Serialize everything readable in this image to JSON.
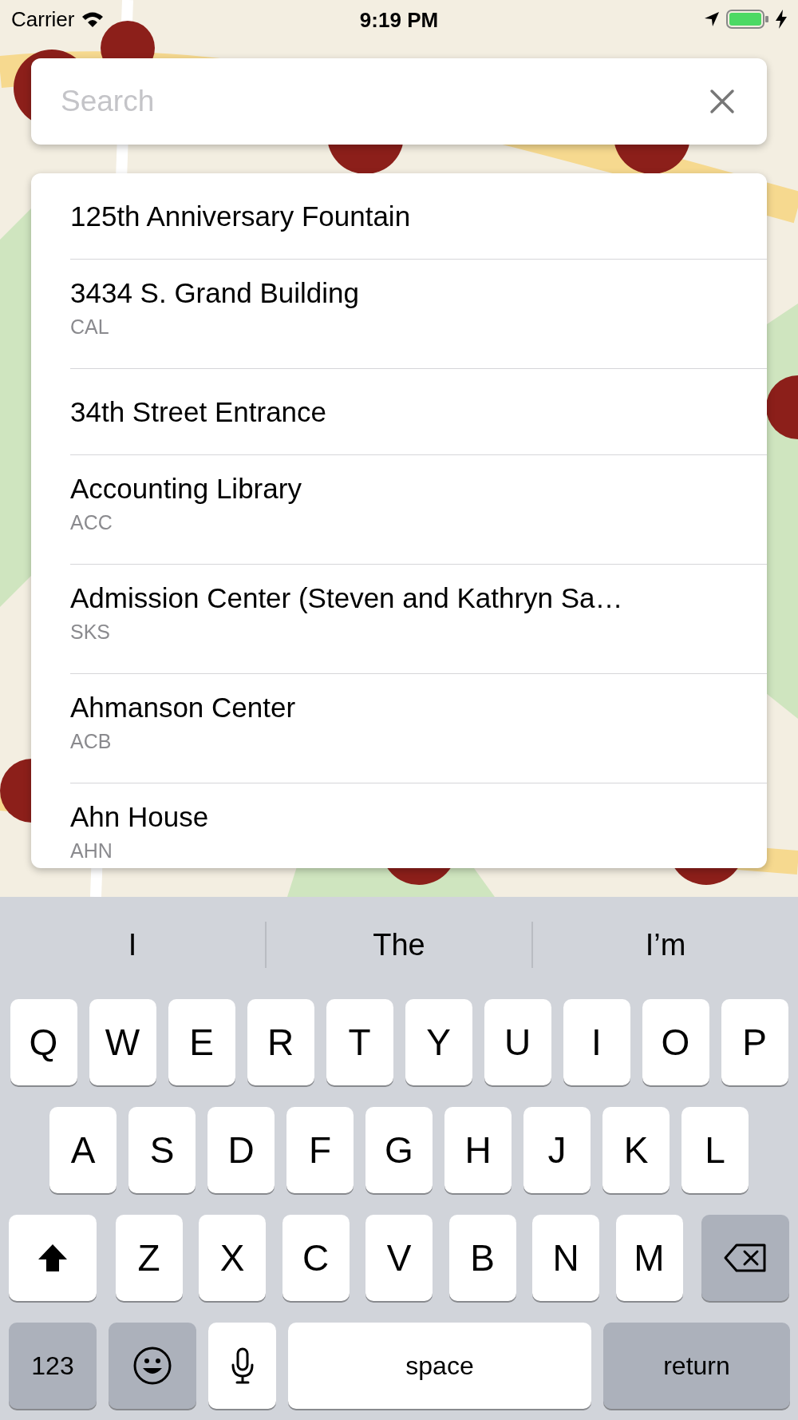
{
  "status_bar": {
    "carrier": "Carrier",
    "time": "9:19 PM"
  },
  "search": {
    "placeholder": "Search"
  },
  "results": [
    {
      "title": "125th Anniversary Fountain"
    },
    {
      "title": "3434 S. Grand Building",
      "code": "CAL"
    },
    {
      "title": "34th Street Entrance"
    },
    {
      "title": "Accounting Library",
      "code": "ACC"
    },
    {
      "title": "Admission Center (Steven and Kathryn Sa…",
      "code": "SKS"
    },
    {
      "title": "Ahmanson Center",
      "code": "ACB"
    },
    {
      "title": "Ahn House",
      "code": "AHN"
    }
  ],
  "keyboard": {
    "suggestions": [
      "I",
      "The",
      "I’m"
    ],
    "rows": [
      {
        "keys": [
          {
            "kind": "letter",
            "label": "Q"
          },
          {
            "kind": "letter",
            "label": "W"
          },
          {
            "kind": "letter",
            "label": "E"
          },
          {
            "kind": "letter",
            "label": "R"
          },
          {
            "kind": "letter",
            "label": "T"
          },
          {
            "kind": "letter",
            "label": "Y"
          },
          {
            "kind": "letter",
            "label": "U"
          },
          {
            "kind": "letter",
            "label": "I"
          },
          {
            "kind": "letter",
            "label": "O"
          },
          {
            "kind": "letter",
            "label": "P"
          }
        ]
      },
      {
        "keys": [
          {
            "kind": "letter",
            "label": "A"
          },
          {
            "kind": "letter",
            "label": "S"
          },
          {
            "kind": "letter",
            "label": "D"
          },
          {
            "kind": "letter",
            "label": "F"
          },
          {
            "kind": "letter",
            "label": "G"
          },
          {
            "kind": "letter",
            "label": "H"
          },
          {
            "kind": "letter",
            "label": "J"
          },
          {
            "kind": "letter",
            "label": "K"
          },
          {
            "kind": "letter",
            "label": "L"
          }
        ]
      },
      {
        "keys": [
          {
            "kind": "shift"
          },
          {
            "kind": "letter",
            "label": "Z"
          },
          {
            "kind": "letter",
            "label": "X"
          },
          {
            "kind": "letter",
            "label": "C"
          },
          {
            "kind": "letter",
            "label": "V"
          },
          {
            "kind": "letter",
            "label": "B"
          },
          {
            "kind": "letter",
            "label": "N"
          },
          {
            "kind": "letter",
            "label": "M"
          },
          {
            "kind": "delete"
          }
        ]
      },
      {
        "keys": [
          {
            "kind": "numbers",
            "label": "123"
          },
          {
            "kind": "emoji"
          },
          {
            "kind": "mic"
          },
          {
            "kind": "space",
            "label": "space"
          },
          {
            "kind": "return",
            "label": "return"
          }
        ]
      }
    ]
  }
}
